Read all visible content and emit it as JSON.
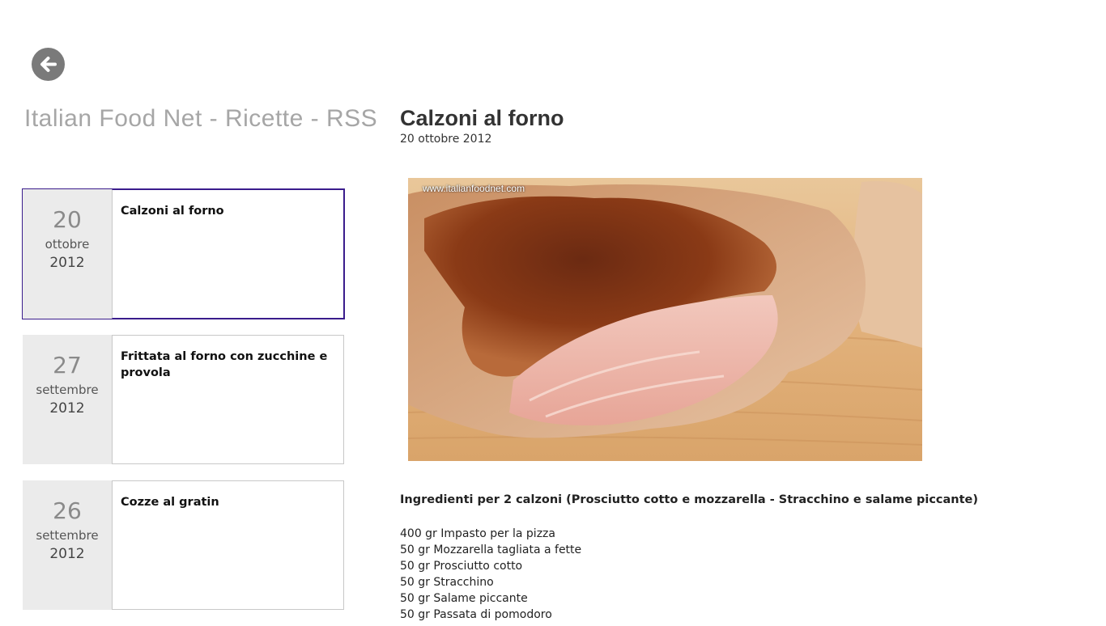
{
  "header": {
    "app_title": "Italian Food Net - Ricette - RSS"
  },
  "feed": {
    "items": [
      {
        "day": "20",
        "month": "ottobre",
        "year": "2012",
        "title": "Calzoni al forno",
        "selected": true
      },
      {
        "day": "27",
        "month": "settembre",
        "year": "2012",
        "title": "Frittata al forno con zucchine e provola",
        "selected": false
      },
      {
        "day": "26",
        "month": "settembre",
        "year": "2012",
        "title": "Cozze al gratin",
        "selected": false
      }
    ]
  },
  "article": {
    "title": "Calzoni al forno",
    "date": "20 ottobre 2012",
    "image_watermark": "www.italianfoodnet.com",
    "ingredients_heading": "Ingredienti per 2 calzoni (Prosciutto cotto e mozzarella - Stracchino e salame piccante)",
    "ingredients": [
      "400 gr Impasto per la pizza",
      "50 gr Mozzarella tagliata a fette",
      "50 gr Prosciutto cotto",
      "50 gr Stracchino",
      "50 gr Salame piccante",
      "50 gr Passata di pomodoro"
    ]
  },
  "icons": {
    "back": "back-arrow-icon"
  },
  "colors": {
    "selection_border": "#3a1c8c",
    "date_tile_bg": "#ebebeb",
    "back_button_bg": "#7a7a7a"
  }
}
